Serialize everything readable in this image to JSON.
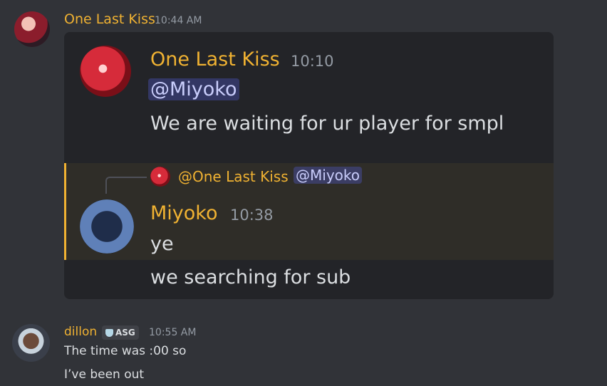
{
  "colors": {
    "background": "#313338",
    "username_gold": "#f0b232",
    "username_main": "#f0b232",
    "embed_bg": "#232428",
    "reply_bar": "#f0b232"
  },
  "message1": {
    "username": "One Last Kiss",
    "timestamp": "10:44 AM",
    "avatar_icon": "avatar-icon"
  },
  "embed": {
    "author": "One Last Kiss",
    "time": "10:10",
    "mention": "@Miyoko",
    "text": "We are waiting for ur player for smpl",
    "reply": {
      "reply_author": "@One Last Kiss",
      "reply_mention": "@Miyoko"
    },
    "reply_msg": {
      "author": "Miyoko",
      "time": "10:38",
      "text1": "ye",
      "text2": "we searching for sub"
    }
  },
  "message2": {
    "username": "dillon",
    "badge": "ASG",
    "timestamp": "10:55 AM",
    "lines": [
      "The time was :00 so",
      "I’ve been out"
    ]
  }
}
